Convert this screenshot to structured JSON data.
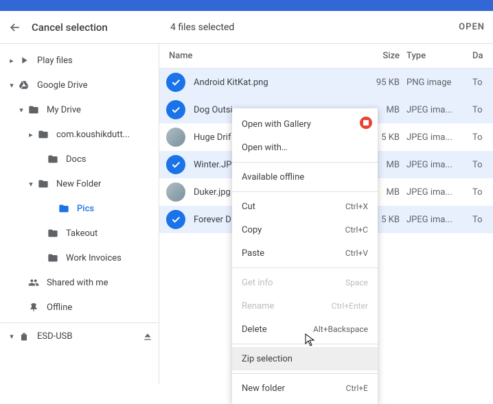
{
  "header": {
    "cancel_label": "Cancel selection",
    "selection_count": "4 files selected",
    "open_label": "OPEN"
  },
  "sidebar": {
    "items": [
      {
        "label": "Play files"
      },
      {
        "label": "Google Drive"
      },
      {
        "label": "My Drive"
      },
      {
        "label": "com.koushikdutt..."
      },
      {
        "label": "Docs"
      },
      {
        "label": "New Folder"
      },
      {
        "label": "Pics"
      },
      {
        "label": "Takeout"
      },
      {
        "label": "Work Invoices"
      },
      {
        "label": "Shared with me"
      },
      {
        "label": "Offline"
      },
      {
        "label": "ESD-USB"
      }
    ]
  },
  "columns": {
    "name": "Name",
    "size": "Size",
    "type": "Type",
    "date": "Da"
  },
  "files": [
    {
      "name": "Android KitKat.png",
      "size": "95 KB",
      "type": "PNG image",
      "date": "To",
      "selected": true
    },
    {
      "name": "Dog Outsi",
      "size": "MB",
      "type": "JPEG ima...",
      "date": "To",
      "selected": true
    },
    {
      "name": "Huge Drif",
      "size": "5 KB",
      "type": "JPEG ima...",
      "date": "To",
      "selected": false
    },
    {
      "name": "Winter.JP",
      "size": "MB",
      "type": "JPEG ima...",
      "date": "To",
      "selected": true
    },
    {
      "name": "Duker.jpg",
      "size": "MB",
      "type": "JPEG ima...",
      "date": "To",
      "selected": false
    },
    {
      "name": "Forever D",
      "size": "5 KB",
      "type": "JPEG ima...",
      "date": "To",
      "selected": true
    }
  ],
  "context_menu": {
    "items": [
      {
        "label": "Open with Gallery",
        "shortcut": ""
      },
      {
        "label": "Open with…",
        "shortcut": ""
      },
      {
        "sep": true
      },
      {
        "label": "Available offline",
        "shortcut": ""
      },
      {
        "sep": true
      },
      {
        "label": "Cut",
        "shortcut": "Ctrl+X"
      },
      {
        "label": "Copy",
        "shortcut": "Ctrl+C"
      },
      {
        "label": "Paste",
        "shortcut": "Ctrl+V"
      },
      {
        "sep": true
      },
      {
        "label": "Get info",
        "shortcut": "Space",
        "disabled": true
      },
      {
        "label": "Rename",
        "shortcut": "Ctrl+Enter",
        "disabled": true
      },
      {
        "label": "Delete",
        "shortcut": "Alt+Backspace"
      },
      {
        "sep": true
      },
      {
        "label": "Zip selection",
        "shortcut": "",
        "hover": true
      },
      {
        "sep": true
      },
      {
        "label": "New folder",
        "shortcut": "Ctrl+E"
      }
    ]
  }
}
